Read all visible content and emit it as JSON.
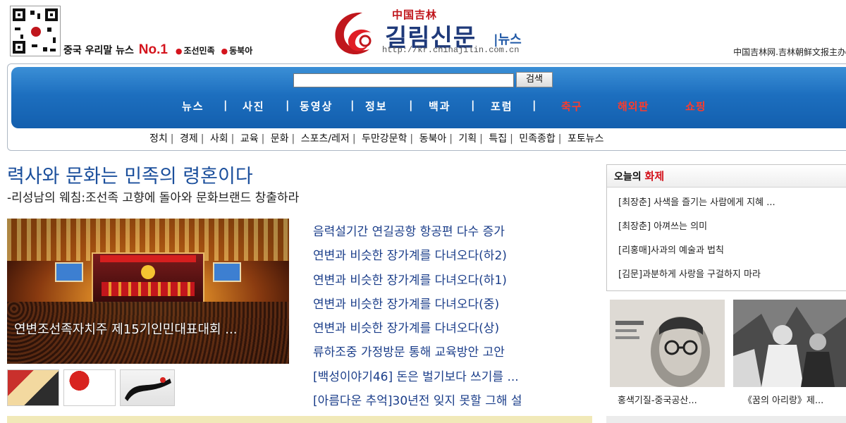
{
  "header": {
    "tagline_prefix": "중국 우리말 뉴스",
    "tagline_no1": "No.1",
    "tagline_item1": "조선민족",
    "tagline_item2": "동북아",
    "logo_cn": "中国吉林",
    "logo_ko": "길림신문",
    "logo_news": "|뉴스",
    "logo_url": "http://kr.chinajilin.com.cn",
    "top_right": "中国吉林网.吉林朝鲜文报主办"
  },
  "search": {
    "value": "",
    "button": "검색"
  },
  "menu": [
    "뉴스",
    "사진",
    "동영상",
    "정보",
    "백과",
    "포럼",
    "축구",
    "해외판",
    "쇼핑"
  ],
  "subnav": [
    "정치",
    "경제",
    "사회",
    "교육",
    "문화",
    "스포츠/레저",
    "두만강문학",
    "동북아",
    "기획",
    "특집",
    "민족종합",
    "포토뉴스"
  ],
  "main": {
    "headline": "력사와 문화는 민족의 령혼이다",
    "subhead": "-리성남의 웨침:조선족 고향에 돌아와 문화브랜드 창출하라",
    "photo_caption": "연변조선족자치주 제15기인민대표대회 ...",
    "news_list": [
      "음력설기간 연길공항 항공편 다수 증가",
      "연변과 비슷한 장가계를 다녀오다(하2)",
      "연변과 비슷한 장가계를 다녀오다(하1)",
      "연변과 비슷한 장가계를 다녀오다(중)",
      "연변과 비슷한 장가계를 다녀오다(상)",
      "류하조중 가정방문 통해 교육방안 고안",
      "[백성이야기46] 돈은 벌기보다 쓰기를 ...",
      "[아름다운 추억]30년전 잊지 못할 그해 설"
    ]
  },
  "hot": {
    "title_prefix": "오늘의 ",
    "title_highlight": "화제",
    "items": [
      "[최장춘] 사색을 즐기는 사람에게 지혜 ...",
      "[최장춘] 아껴쓰는 의미",
      "[리홍매]사과의 예술과 법칙",
      "[김문]과분하게 사랑을 구걸하지 마라"
    ]
  },
  "side_photos": [
    {
      "caption": "홍색기질-중국공산..."
    },
    {
      "caption": "《꿈의 아리랑》제..."
    }
  ],
  "colors": {
    "nav_blue": "#1d6fbf",
    "headline_blue": "#1b4f9c",
    "accent_red": "#d4141d"
  }
}
